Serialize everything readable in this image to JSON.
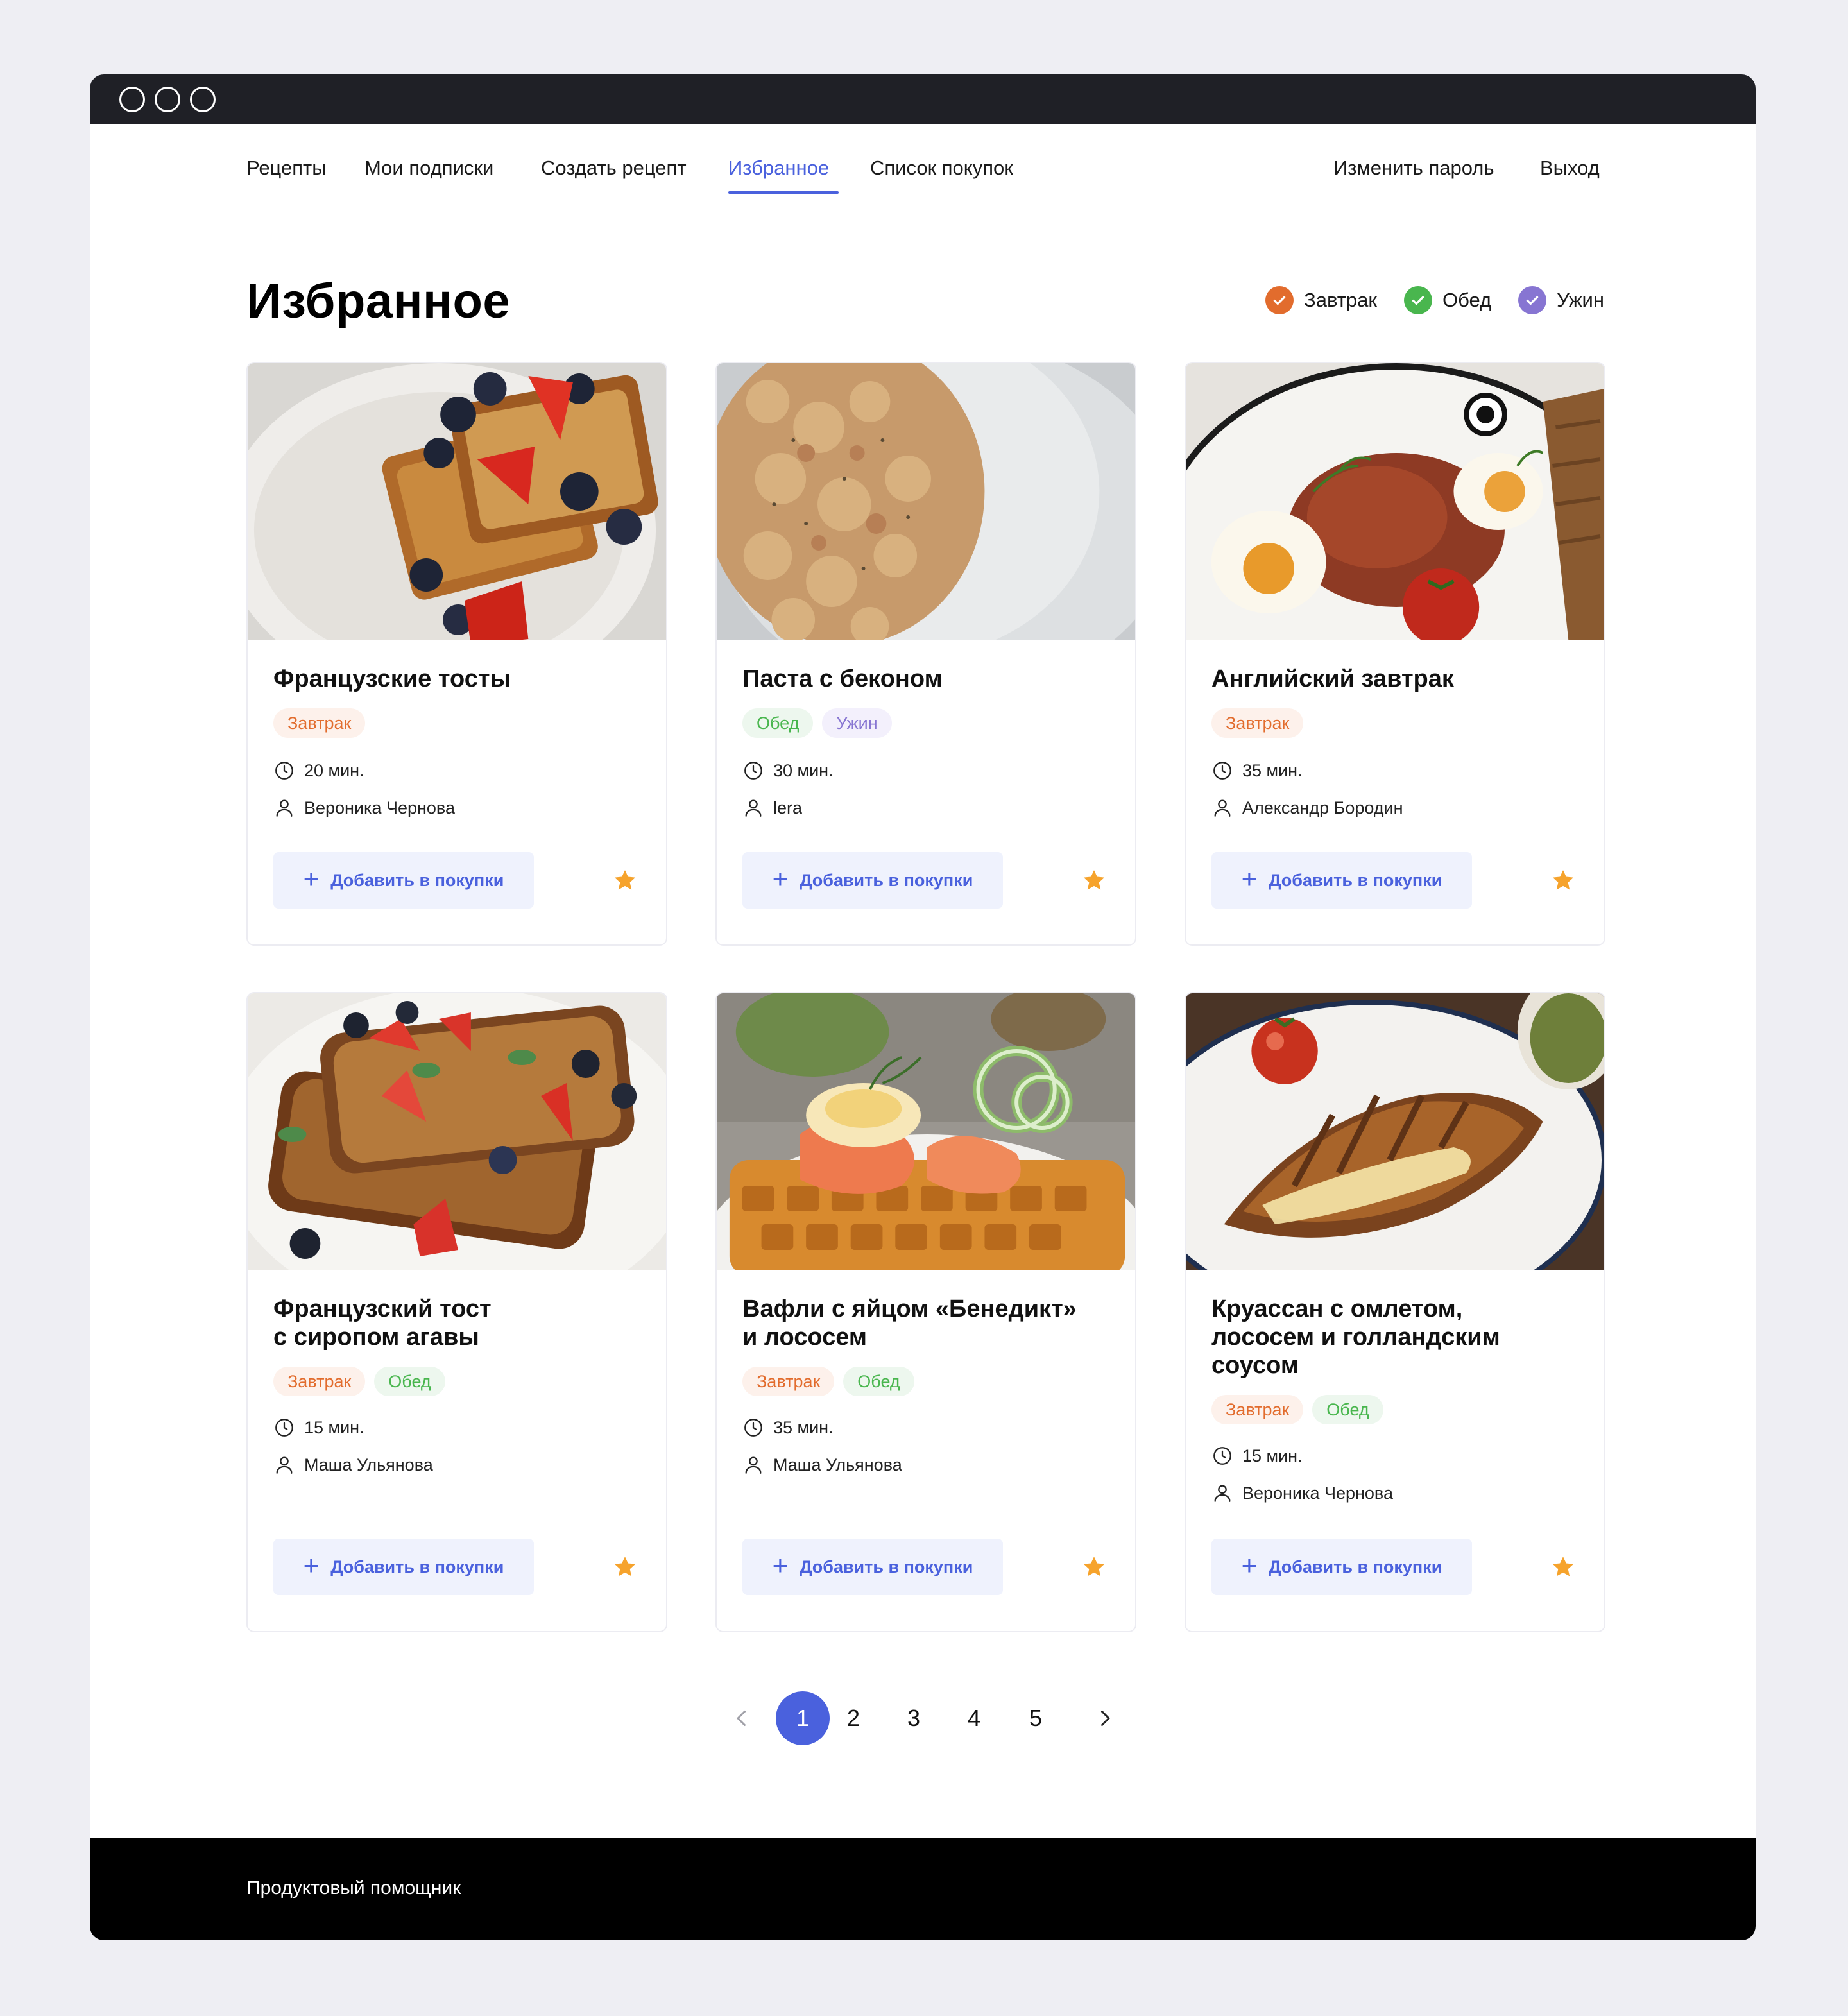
{
  "nav": {
    "items": [
      "Рецепты",
      "Мои подписки",
      "Создать рецепт",
      "Избранное",
      "Список покупок"
    ],
    "change_password": "Изменить пароль",
    "logout": "Выход"
  },
  "page": {
    "title": "Избранное"
  },
  "filters": [
    {
      "label": "Завтрак",
      "color": "#E26C2D"
    },
    {
      "label": "Обед",
      "color": "#49B64E"
    },
    {
      "label": "Ужин",
      "color": "#8775D2"
    }
  ],
  "add_label": "Добавить в покупки",
  "recipes": [
    {
      "title": "Французские тосты",
      "tags": [
        "Завтрак"
      ],
      "time": "20 мин.",
      "author": "Вероника Чернова"
    },
    {
      "title": "Паста с беконом",
      "tags": [
        "Обед",
        "Ужин"
      ],
      "time": "30 мин.",
      "author": "lera"
    },
    {
      "title": "Английский завтрак",
      "tags": [
        "Завтрак"
      ],
      "time": "35 мин.",
      "author": "Александр Бородин"
    },
    {
      "title": "Французский тост\nс сиропом агавы",
      "tags": [
        "Завтрак",
        "Обед"
      ],
      "time": "15 мин.",
      "author": "Маша  Ульянова"
    },
    {
      "title": "Вафли с яйцом «Бенедикт»\nи лососем",
      "tags": [
        "Завтрак",
        "Обед"
      ],
      "time": "35 мин.",
      "author": "Маша  Ульянова"
    },
    {
      "title": "Круассан с омлетом,\nлососем и голландским\nсоусом",
      "tags": [
        "Завтрак",
        "Обед"
      ],
      "time": "15 мин.",
      "author": "Вероника Чернова"
    }
  ],
  "pagination": {
    "pages": [
      "1",
      "2",
      "3",
      "4",
      "5"
    ],
    "current": "1"
  },
  "footer": {
    "text": "Продуктовый помощник"
  },
  "icons": [
    "clock-icon",
    "user-icon",
    "star-icon",
    "plus-icon",
    "chevron-left-icon",
    "chevron-right-icon",
    "check-icon"
  ]
}
